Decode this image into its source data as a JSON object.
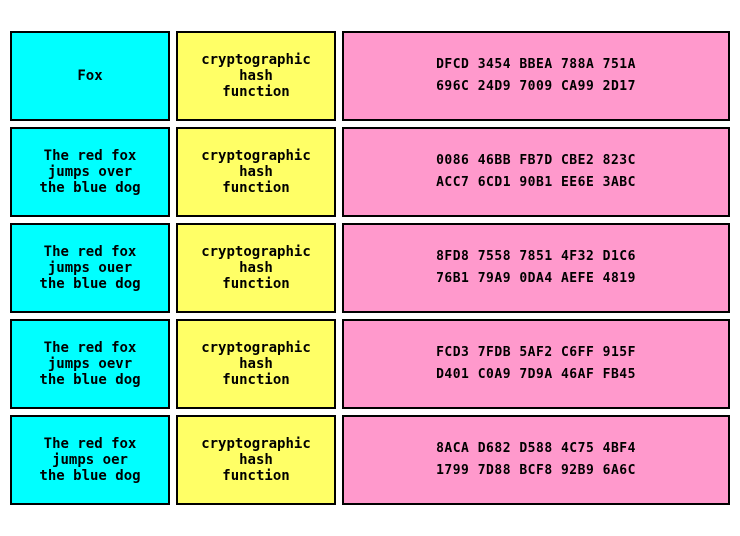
{
  "rows": [
    {
      "input": "Fox",
      "hash_label": "cryptographic\nhash\nfunction",
      "output_line1": "DFCD  3454  BBEA  788A  751A",
      "output_line2": "696C  24D9  7009  CA99  2D17"
    },
    {
      "input": "The red fox\njumps over\nthe blue dog",
      "hash_label": "cryptographic\nhash\nfunction",
      "output_line1": "0086  46BB  FB7D  CBE2  823C",
      "output_line2": "ACC7  6CD1  90B1  EE6E  3ABC"
    },
    {
      "input": "The red fox\njumps ouer\nthe blue dog",
      "hash_label": "cryptographic\nhash\nfunction",
      "output_line1": "8FD8  7558  7851  4F32  D1C6",
      "output_line2": "76B1  79A9  0DA4  AEFE  4819"
    },
    {
      "input": "The red fox\njumps oevr\nthe blue dog",
      "hash_label": "cryptographic\nhash\nfunction",
      "output_line1": "FCD3  7FDB  5AF2  C6FF  915F",
      "output_line2": "D401  C0A9  7D9A  46AF  FB45"
    },
    {
      "input": "The red fox\njumps oer\nthe blue dog",
      "hash_label": "cryptographic\nhash\nfunction",
      "output_line1": "8ACA  D682  D588  4C75  4BF4",
      "output_line2": "1799  7D88  BCF8  92B9  6A6C"
    }
  ]
}
